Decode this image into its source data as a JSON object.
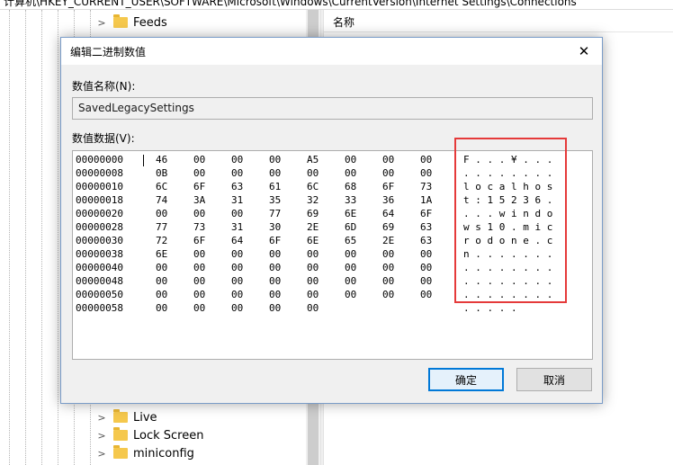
{
  "address_bar": "计算机\\HKEY_CURRENT_USER\\SOFTWARE\\Microsoft\\Windows\\CurrentVersion\\Internet Settings\\Connections",
  "tree": {
    "items": [
      {
        "label": "Feeds"
      },
      {
        "label": "Live"
      },
      {
        "label": "Lock Screen"
      },
      {
        "label": "miniconfig"
      }
    ]
  },
  "list": {
    "name_header": "名称"
  },
  "dialog": {
    "title": "编辑二进制数值",
    "name_label": "数值名称(N):",
    "name_value": "SavedLegacySettings",
    "data_label": "数值数据(V):",
    "hex_rows": [
      {
        "offset": "00000000",
        "bytes": [
          "46",
          "00",
          "00",
          "00",
          "A5",
          "00",
          "00",
          "00"
        ],
        "ascii": "F . . . ¥ . . ."
      },
      {
        "offset": "00000008",
        "bytes": [
          "0B",
          "00",
          "00",
          "00",
          "00",
          "00",
          "00",
          "00"
        ],
        "ascii": ". . . . . . . ."
      },
      {
        "offset": "00000010",
        "bytes": [
          "6C",
          "6F",
          "63",
          "61",
          "6C",
          "68",
          "6F",
          "73"
        ],
        "ascii": "l o c a l h o s"
      },
      {
        "offset": "00000018",
        "bytes": [
          "74",
          "3A",
          "31",
          "35",
          "32",
          "33",
          "36",
          "1A"
        ],
        "ascii": "t : 1 5 2 3 6 ."
      },
      {
        "offset": "00000020",
        "bedytes": [],
        "bytes": [
          "00",
          "00",
          "00",
          "77",
          "69",
          "6E",
          "64",
          "6F"
        ],
        "ascii": ". . . w i n d o"
      },
      {
        "offset": "00000028",
        "bytes": [
          "77",
          "73",
          "31",
          "30",
          "2E",
          "6D",
          "69",
          "63"
        ],
        "ascii": "w s 1 0 . m i c"
      },
      {
        "offset": "00000030",
        "bytes": [
          "72",
          "6F",
          "64",
          "6F",
          "6E",
          "65",
          "2E",
          "63"
        ],
        "ascii": "r o d o n e . c"
      },
      {
        "offset": "00000038",
        "bytes": [
          "6E",
          "00",
          "00",
          "00",
          "00",
          "00",
          "00",
          "00"
        ],
        "ascii": "n . . . . . . ."
      },
      {
        "offset": "00000040",
        "bytes": [
          "00",
          "00",
          "00",
          "00",
          "00",
          "00",
          "00",
          "00"
        ],
        "ascii": ". . . . . . . ."
      },
      {
        "offset": "00000048",
        "bytes": [
          "00",
          "00",
          "00",
          "00",
          "00",
          "00",
          "00",
          "00"
        ],
        "ascii": ". . . . . . . ."
      },
      {
        "offset": "00000050",
        "bytes": [
          "00",
          "00",
          "00",
          "00",
          "00",
          "00",
          "00",
          "00"
        ],
        "ascii": ". . . . . . . ."
      },
      {
        "offset": "00000058",
        "bytes": [
          "00",
          "00",
          "00",
          "00",
          "00"
        ],
        "ascii": ". . . . ."
      }
    ],
    "ok_label": "确定",
    "cancel_label": "取消",
    "close_glyph": "✕"
  },
  "colors": {
    "annotation": "#e53a3a",
    "primary_border": "#0078d7"
  }
}
